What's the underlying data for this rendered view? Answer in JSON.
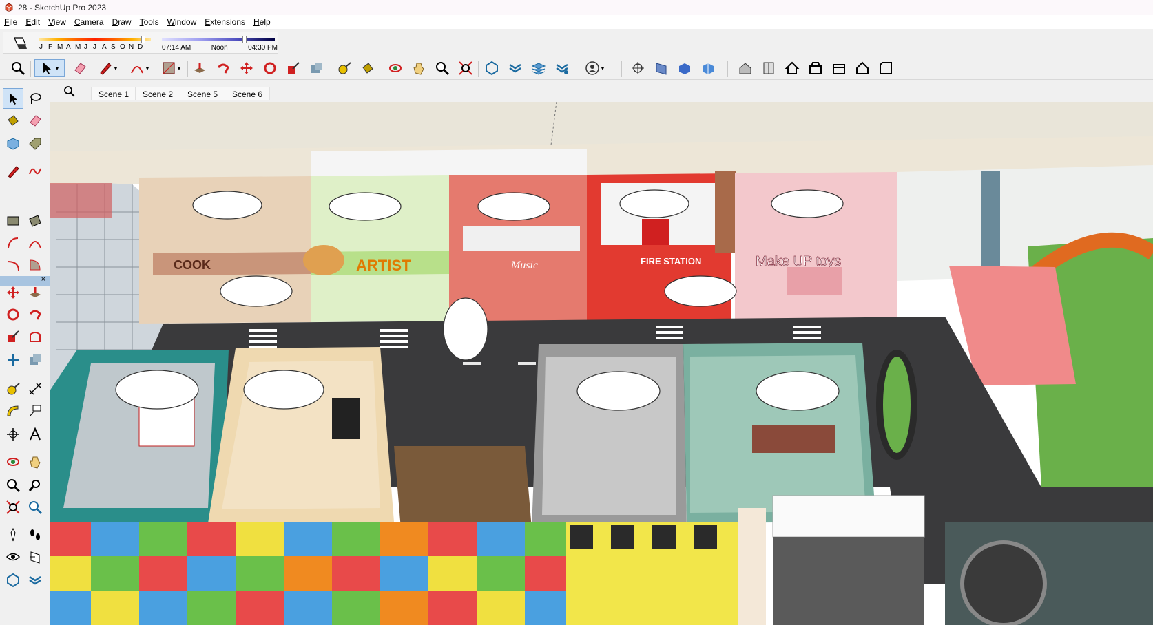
{
  "window": {
    "title": "28 - SketchUp Pro 2023"
  },
  "menu": {
    "items": [
      "File",
      "Edit",
      "View",
      "Camera",
      "Draw",
      "Tools",
      "Window",
      "Extensions",
      "Help"
    ]
  },
  "shadows": {
    "months": [
      "J",
      "F",
      "M",
      "A",
      "M",
      "J",
      "J",
      "A",
      "S",
      "O",
      "N",
      "D"
    ],
    "month_level": 0.93,
    "time_start": "07:14 AM",
    "time_mid": "Noon",
    "time_end": "04:30 PM",
    "time_level": 0.73
  },
  "scenes": {
    "tabs": [
      "Scene 1",
      "Scene 2",
      "Scene 5",
      "Scene 6"
    ]
  },
  "float_panel": {
    "close": "×"
  },
  "model": {
    "signs": {
      "cook": "COOK",
      "artist": "ARTIST",
      "music": "Music",
      "fire_station": "FIRE STATION",
      "makeup": "Make UP toys"
    }
  },
  "colors": {
    "toolbar_bg": "#f0f0f0",
    "accent": "#cfe3f7",
    "road": "#3a3a3c",
    "sky": "#e9e5d9"
  }
}
